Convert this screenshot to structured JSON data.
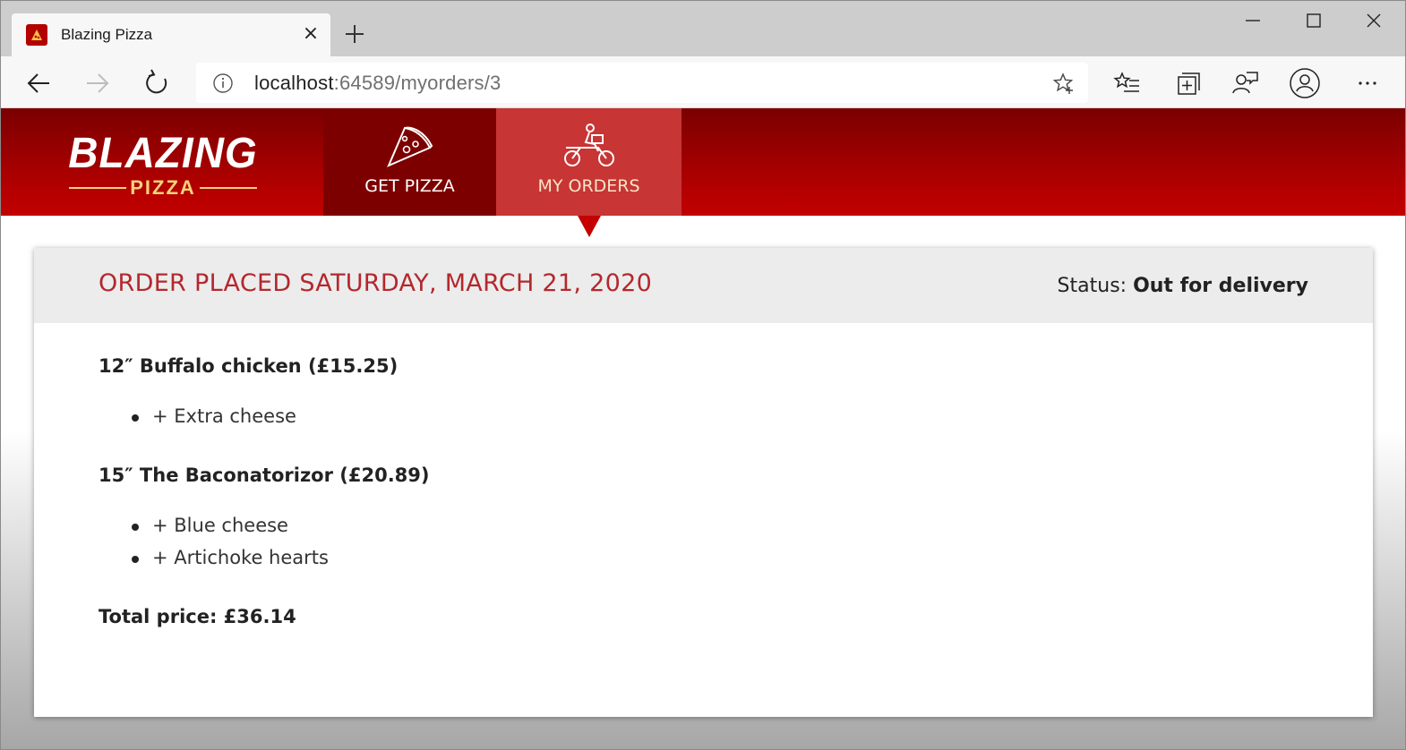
{
  "browser": {
    "tab_title": "Blazing Pizza",
    "tab_close": "×",
    "address_host": "localhost",
    "address_rest": ":64589/myorders/3"
  },
  "app": {
    "logo_main": "BLAZING",
    "logo_sub": "PIZZA",
    "nav": {
      "get_pizza": "GET PIZZA",
      "my_orders": "MY ORDERS"
    },
    "colors": {
      "header_red": "#b00000",
      "active_tab": "#c73535",
      "title_red": "#b3282d",
      "logo_gold": "#f5d37a"
    }
  },
  "order": {
    "title": "ORDER PLACED SATURDAY, MARCH 21, 2020",
    "status_label": "Status: ",
    "status_value": "Out for delivery",
    "pizzas": [
      {
        "label": "12″ Buffalo chicken (£15.25)",
        "toppings": [
          "+ Extra cheese"
        ]
      },
      {
        "label": "15″ The Baconatorizor (£20.89)",
        "toppings": [
          "+ Blue cheese",
          "+ Artichoke hearts"
        ]
      }
    ],
    "total": "Total price: £36.14"
  }
}
